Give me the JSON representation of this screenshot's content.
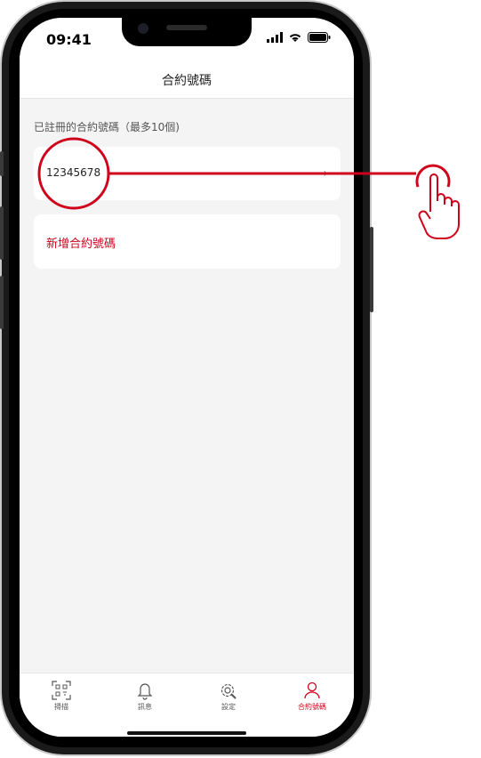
{
  "status_bar": {
    "time": "09:41"
  },
  "nav": {
    "title": "合約號碼"
  },
  "section_label": "已註冊的合約號碼（最多10個)",
  "contract": {
    "number": "12345678"
  },
  "add_contract": {
    "label": "新增合約號碼"
  },
  "tabs": [
    {
      "label": "掃描",
      "icon": "qr-scan-icon"
    },
    {
      "label": "訊息",
      "icon": "bell-icon"
    },
    {
      "label": "設定",
      "icon": "gear-icon"
    },
    {
      "label": "合約號碼",
      "icon": "person-icon"
    }
  ],
  "colors": {
    "accent": "#d0021b",
    "background": "#f4f4f4"
  }
}
